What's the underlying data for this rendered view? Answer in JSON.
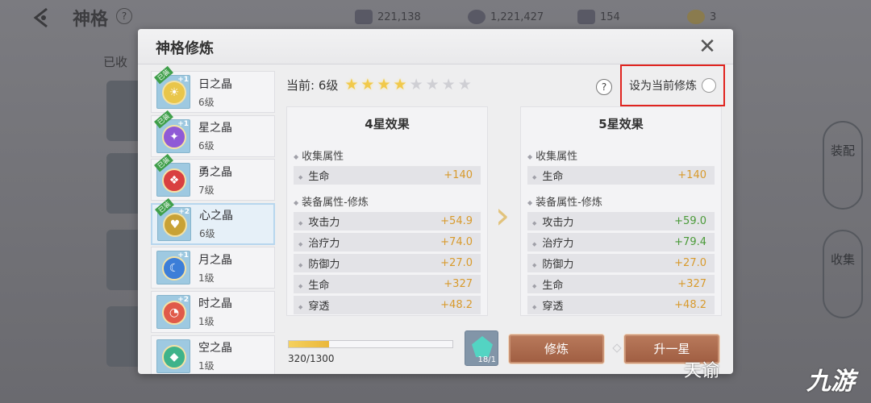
{
  "page": {
    "title": "神格",
    "help_glyph": "?",
    "collected_label": "已收",
    "resources": [
      "221,138",
      "1,221,427",
      "154",
      "3"
    ],
    "side_buttons": [
      "装配",
      "收集"
    ]
  },
  "modal": {
    "title": "神格修炼",
    "close_glyph": "✕",
    "current_label": "当前: 6级",
    "stars_total": 8,
    "stars_filled": 4,
    "help_glyph": "?",
    "set_current_label": "设为当前修炼",
    "crystals": [
      {
        "name": "日之晶",
        "level": "6级",
        "badge": "已装",
        "plus": "+1",
        "color": "#e9c64a",
        "glyph": "☀"
      },
      {
        "name": "星之晶",
        "level": "6级",
        "badge": "已装",
        "plus": "+1",
        "color": "#8f5ad6",
        "glyph": "✦"
      },
      {
        "name": "勇之晶",
        "level": "7级",
        "badge": "已装",
        "plus": "",
        "color": "#d94040",
        "glyph": "❖"
      },
      {
        "name": "心之晶",
        "level": "6级",
        "badge": "已装",
        "plus": "+2",
        "color": "#c8a236",
        "glyph": "♥"
      },
      {
        "name": "月之晶",
        "level": "1级",
        "badge": "",
        "plus": "+1",
        "color": "#3c7ed8",
        "glyph": "☾"
      },
      {
        "name": "时之晶",
        "level": "1级",
        "badge": "",
        "plus": "+2",
        "color": "#e05a4a",
        "glyph": "◔"
      },
      {
        "name": "空之晶",
        "level": "1级",
        "badge": "",
        "plus": "",
        "color": "#3fb38a",
        "glyph": "◆"
      }
    ],
    "panels": [
      {
        "title": "4星效果",
        "collect_head": "收集属性",
        "collect": [
          {
            "name": "生命",
            "value": "+140"
          }
        ],
        "equip_head": "装备属性-修炼",
        "equip": [
          {
            "name": "攻击力",
            "value": "+54.9"
          },
          {
            "name": "治疗力",
            "value": "+74.0"
          },
          {
            "name": "防御力",
            "value": "+27.0"
          },
          {
            "name": "生命",
            "value": "+327"
          },
          {
            "name": "穿透",
            "value": "+48.2"
          }
        ]
      },
      {
        "title": "5星效果",
        "collect_head": "收集属性",
        "collect": [
          {
            "name": "生命",
            "value": "+140"
          }
        ],
        "equip_head": "装备属性-修炼",
        "equip": [
          {
            "name": "攻击力",
            "value": "+59.0",
            "changed": true
          },
          {
            "name": "治疗力",
            "value": "+79.4",
            "changed": true
          },
          {
            "name": "防御力",
            "value": "+27.0"
          },
          {
            "name": "生命",
            "value": "+327"
          },
          {
            "name": "穿透",
            "value": "+48.2"
          }
        ]
      }
    ],
    "progress_text": "320/1300",
    "progress_fraction": 0.246,
    "material_count": "18/1",
    "train_button": "修炼",
    "upgrade_button": "升一星"
  },
  "watermark": {
    "text": "天谕",
    "logo": "九游"
  }
}
